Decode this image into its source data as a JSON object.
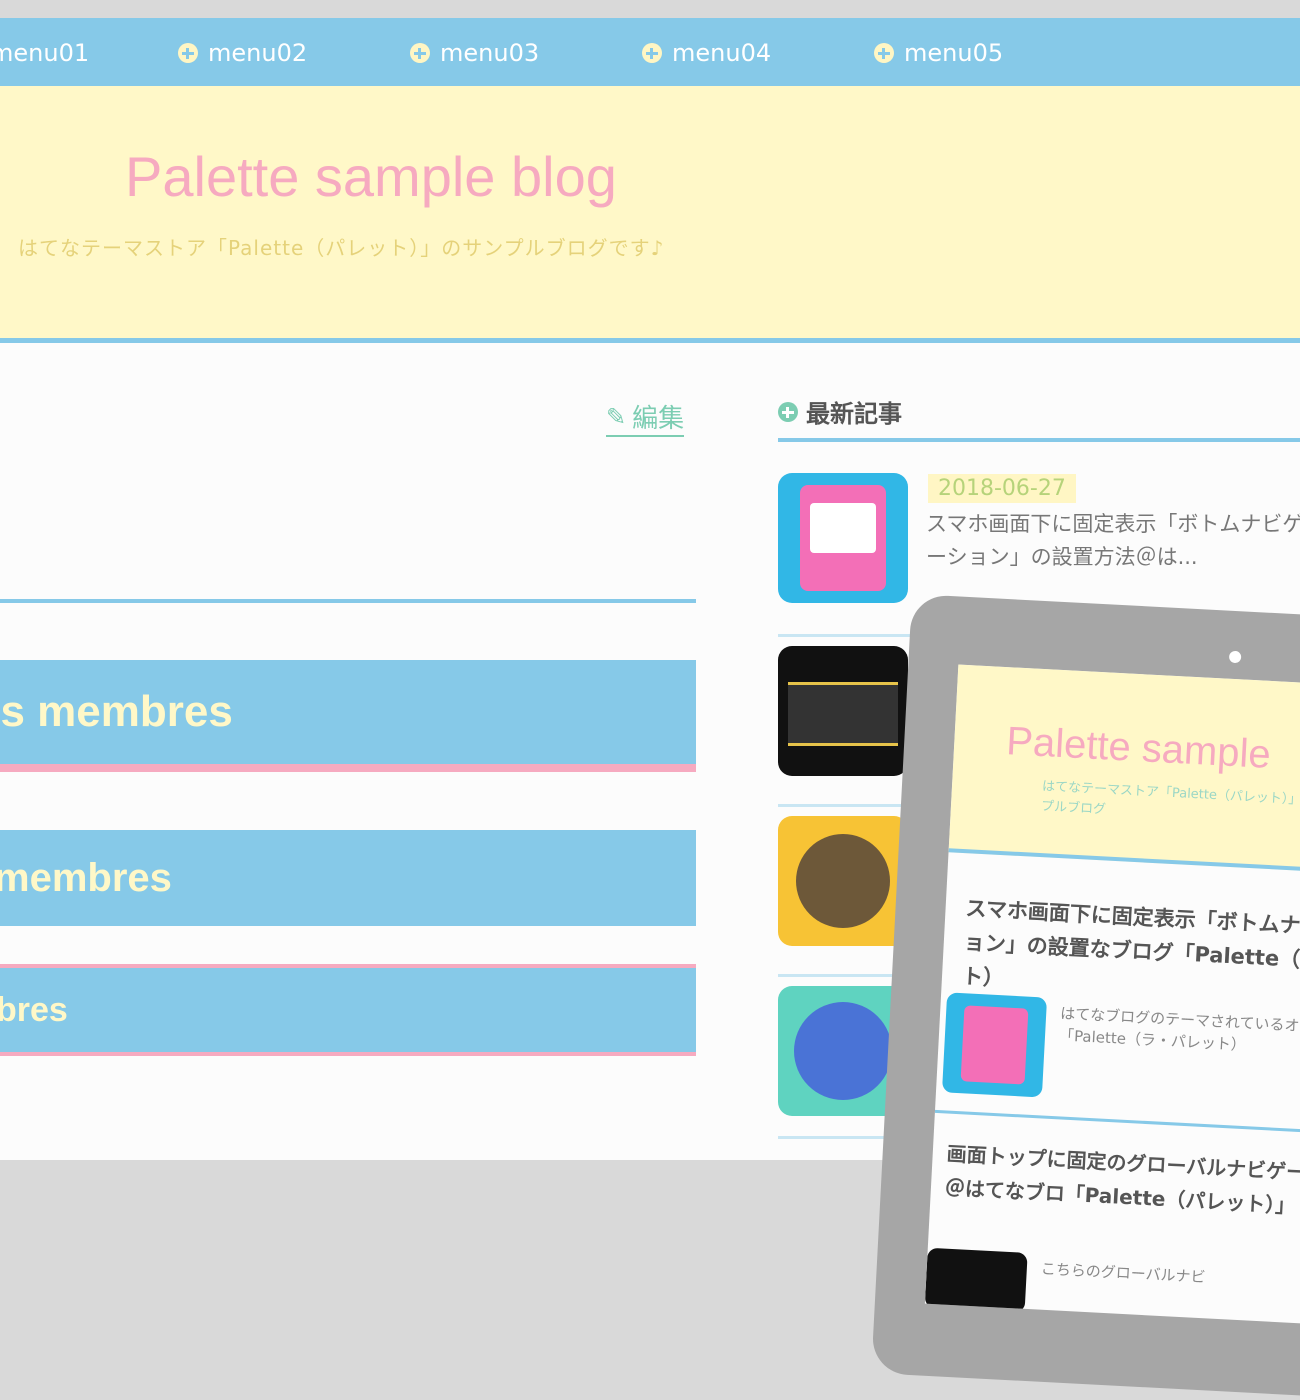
{
  "nav": {
    "items": [
      "menu01",
      "menu02",
      "menu03",
      "menu04",
      "menu05"
    ]
  },
  "header": {
    "title": "Palette sample blog",
    "description": "はてなテーマストア「Palette（パレット）」のサンプルブログです♪"
  },
  "main": {
    "edit_label": "編集",
    "headings": [
      "es membres",
      "membres",
      "bres"
    ]
  },
  "sidebar": {
    "title": "最新記事",
    "entries": [
      {
        "date": "2018-06-27",
        "title": "スマホ画面下に固定表示「ボトムナビゲーション」の設置方法＠は..."
      }
    ]
  },
  "tablet": {
    "title": "Palette sample",
    "description": "はてなテーマストア「Palette（パレット）」のサンプルブログ",
    "article1_title": "スマホ画面下に固定表示「ボトムナビゲーション」の設置なブログ「Palette（パレット）",
    "article1_excerpt": "はてなブログのテーマされているオリジナル「Palette（ラ・パレット）",
    "article2_title": "画面トップに固定のグローバルナビゲーション＠はてなブロ「Palette（パレット）」",
    "article2_excerpt": "こちらのグローバルナビ"
  },
  "colors": {
    "nav_blue": "#86c9e8",
    "header_yellow": "#fff8c8",
    "title_pink": "#f6aac0",
    "accent_green": "#7ccdb2"
  }
}
